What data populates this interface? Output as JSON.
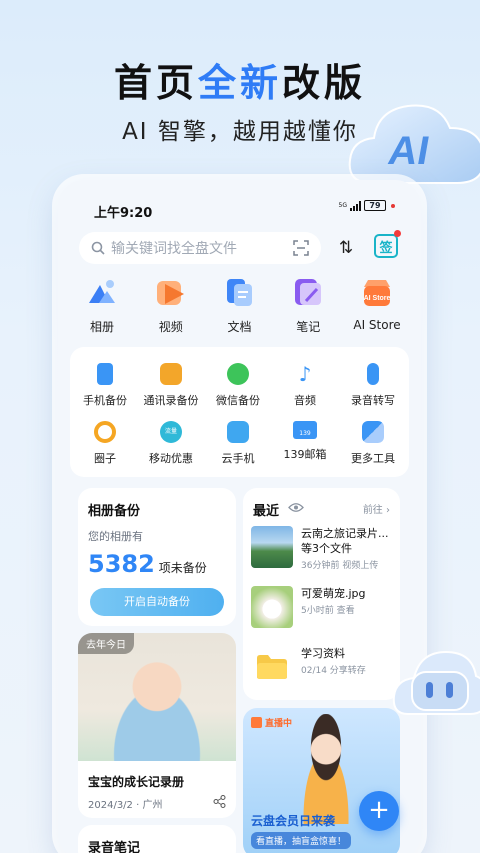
{
  "promo": {
    "title_a": "首页",
    "title_b": "全新",
    "title_c": "改版",
    "subtitle": "AI 智擎，越用越懂你",
    "ai_badge": "AI"
  },
  "status": {
    "time": "上午9:20",
    "network": "5G",
    "battery": "79"
  },
  "search": {
    "placeholder": "输关键词找全盘文件",
    "sign_label": "签",
    "sort_icon": "⇅"
  },
  "quick_access": [
    {
      "label": "相册",
      "color": "#3b7ff5"
    },
    {
      "label": "视频",
      "color": "#f5782f"
    },
    {
      "label": "文档",
      "color": "#3f86f7"
    },
    {
      "label": "笔记",
      "color": "#8a5cf0"
    },
    {
      "label": "AI Store",
      "color": "#ff7a3a",
      "badge": "AI Store"
    }
  ],
  "tools": [
    {
      "label": "手机备份",
      "color": "#3a95f5"
    },
    {
      "label": "通讯录备份",
      "color": "#f3a62a"
    },
    {
      "label": "微信备份",
      "color": "#3dc45a"
    },
    {
      "label": "音频",
      "color": "#3a95f5"
    },
    {
      "label": "录音转写",
      "color": "#3a95f5"
    },
    {
      "label": "圈子",
      "color": "#f5a623"
    },
    {
      "label": "移动优惠",
      "color": "#2fb9d8",
      "badge": "流量"
    },
    {
      "label": "云手机",
      "color": "#3fa7f0"
    },
    {
      "label": "139邮箱",
      "color": "#3a95f5",
      "badge": "139"
    },
    {
      "label": "更多工具",
      "color": "#3a95f5"
    }
  ],
  "album_backup": {
    "title": "相册备份",
    "desc": "您的相册有",
    "count": "5382",
    "count_suffix": "项未备份",
    "button": "开启自动备份"
  },
  "recent": {
    "title": "最近",
    "more": "前往",
    "items": [
      {
        "name": "云南之旅记录片...",
        "name2": "等3个文件",
        "meta": "36分钟前  视频上传"
      },
      {
        "name": "可爱萌宠.jpg",
        "meta": "5小时前  查看"
      },
      {
        "name": "学习资料",
        "meta": "02/14  分享转存"
      }
    ]
  },
  "memory": {
    "tag": "去年今日",
    "title": "宝宝的成长记录册",
    "meta": "2024/3/2 · 广州"
  },
  "live": {
    "badge": "直播中",
    "title": "云盘会员日来袭",
    "subtitle": "看直播，抽盲盒惊喜！"
  },
  "audio_notes": {
    "title": "录音笔记"
  },
  "fab": "+"
}
